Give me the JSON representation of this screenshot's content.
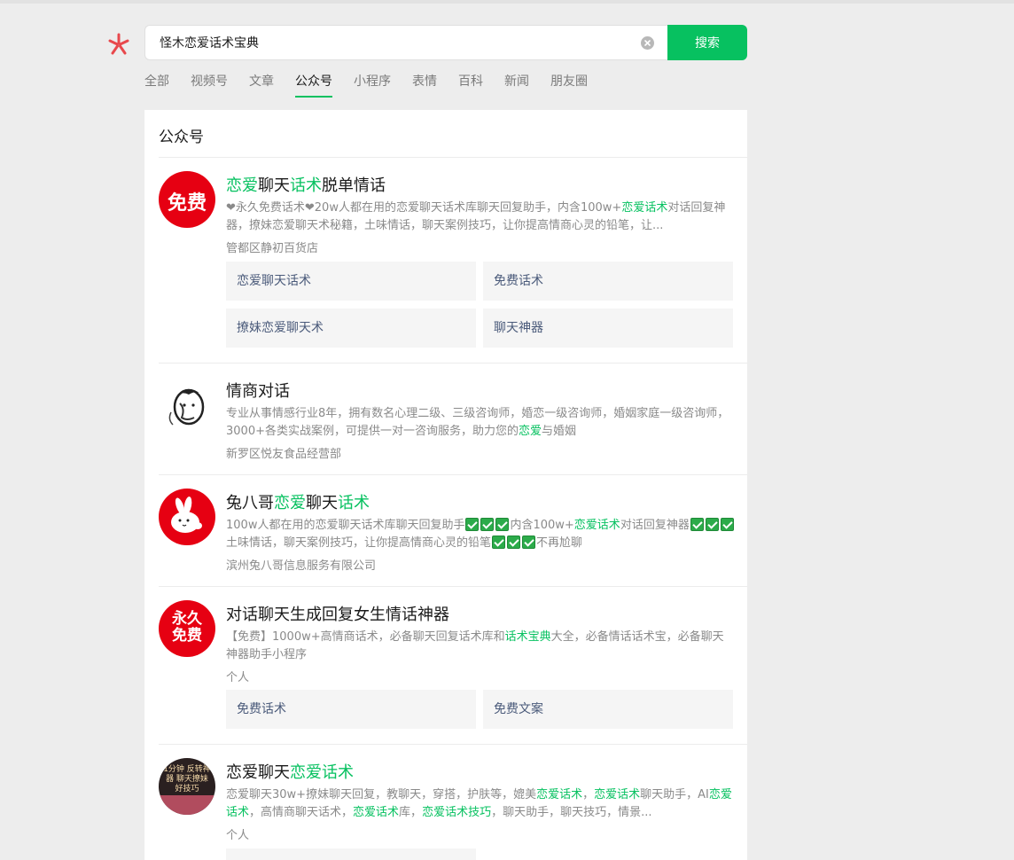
{
  "search": {
    "query": "怪木恋爱话术宝典",
    "button_label": "搜索"
  },
  "tabs": [
    {
      "label": "全部",
      "active": false
    },
    {
      "label": "视频号",
      "active": false
    },
    {
      "label": "文章",
      "active": false
    },
    {
      "label": "公众号",
      "active": true
    },
    {
      "label": "小程序",
      "active": false
    },
    {
      "label": "表情",
      "active": false
    },
    {
      "label": "百科",
      "active": false
    },
    {
      "label": "新闻",
      "active": false
    },
    {
      "label": "朋友圈",
      "active": false
    }
  ],
  "section_title": "公众号",
  "colors": {
    "accent": "#07c160",
    "avatar_red": "#e60012"
  },
  "results": [
    {
      "title": [
        "恋爱",
        "聊天",
        "话术",
        "脱单情话"
      ],
      "avatar_text": "免费",
      "desc": [
        "❤永久免费话术❤20w人都在用的恋爱聊天话术库聊天回复助手，内含100w+",
        "恋爱话术",
        "对话回复神器，撩妹恋爱聊天术秘籍，土味情话，聊天案例技巧，让你提高情商心灵的铅笔，让..."
      ],
      "subtitle": "管都区静初百货店",
      "cards": [
        "恋爱聊天话术",
        "免费话术",
        "撩妹恋爱聊天术",
        "聊天神器"
      ]
    },
    {
      "title": [
        "情商对话"
      ],
      "avatar_icon": "portrait-icon",
      "desc": [
        "专业从事情感行业8年，拥有数名心理二级、三级咨询师，婚恋一级咨询师，婚姻家庭一级咨询师，3000+各类实战案例，可提供一对一咨询服务，助力您的",
        "恋爱",
        "与婚姻"
      ],
      "subtitle": "新罗区悦友食品经营部"
    },
    {
      "title": [
        "兔八哥",
        "恋爱",
        "聊天",
        "话术"
      ],
      "avatar_icon": "bunny-icon",
      "desc": [
        "100w人都在用的恋爱聊天话术库聊天回复助手",
        "内含100w+",
        "恋爱话术",
        "对话回复神器",
        "土味情话，聊天案例技巧，让你提高情商心灵的铅笔",
        "不再尬聊"
      ],
      "subtitle": "滨州兔八哥信息服务有限公司"
    },
    {
      "title": [
        "对话聊天生成回复女生情话神器"
      ],
      "avatar_text": "永久免费",
      "desc": [
        "【免费】1000w+高情商话术，必备聊天回复话术库和",
        "话术宝典",
        "大全，必备情话话术宝，必备聊天神器助手小程序"
      ],
      "subtitle": "个人",
      "cards": [
        "免费话术",
        "免费文案"
      ]
    },
    {
      "title": [
        "恋爱聊天",
        "恋爱话术"
      ],
      "avatar_text": "1分钟 反转神器 聊天撩妹 好技巧",
      "desc": [
        "恋爱聊天30w+撩妹聊天回复，教聊天，穿搭，护肤等，媲美",
        "恋爱话术",
        "，",
        "恋爱话术",
        "聊天助手，AI",
        "恋爱话术",
        "，高情商聊天话术，",
        "恋爱话术",
        "库，",
        "恋爱话术技巧",
        "，聊天助手，聊天技巧，情景..."
      ],
      "subtitle": "个人"
    }
  ]
}
